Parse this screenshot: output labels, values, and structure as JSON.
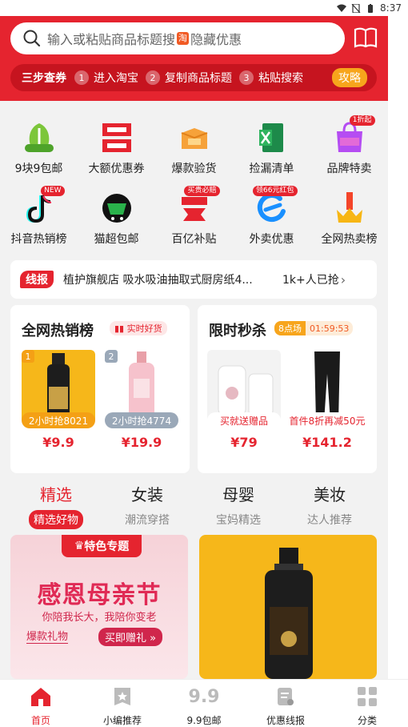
{
  "status": {
    "time": "8:37"
  },
  "search": {
    "placeholder_pre": "输入或粘贴商品标题搜",
    "badge": "淘",
    "placeholder_post": "隐藏优惠"
  },
  "steps": {
    "lead": "三步查券",
    "items": [
      {
        "num": "1",
        "label": "进入淘宝"
      },
      {
        "num": "2",
        "label": "复制商品标题"
      },
      {
        "num": "3",
        "label": "粘贴搜索"
      }
    ],
    "guide": "攻略"
  },
  "categories": [
    {
      "label": "9块9包邮",
      "icon": "white-price-icon",
      "tag": ""
    },
    {
      "label": "大额优惠券",
      "icon": "coupon-drop-icon",
      "tag": ""
    },
    {
      "label": "爆款验货",
      "icon": "unbox-icon",
      "tag": ""
    },
    {
      "label": "捡漏清单",
      "icon": "excel-list-icon",
      "tag": ""
    },
    {
      "label": "品牌特卖",
      "icon": "sale-bag-icon",
      "tag": "1折起"
    },
    {
      "label": "抖音热销榜",
      "icon": "tiktok-icon",
      "tag": "NEW"
    },
    {
      "label": "猫超包邮",
      "icon": "supermarket-icon",
      "tag": ""
    },
    {
      "label": "百亿补贴",
      "icon": "ju-icon",
      "tag": "买贵必赔"
    },
    {
      "label": "外卖优惠",
      "icon": "eleme-icon",
      "tag": "领66元红包"
    },
    {
      "label": "全网热卖榜",
      "icon": "crown-icon",
      "tag": ""
    }
  ],
  "news": {
    "badge": "线报",
    "text": "植护旗舰店 吸水吸油抽取式厨房纸4...",
    "count": "1k+人已抢"
  },
  "hot": {
    "title": "全网热销榜",
    "badge": "实时好货",
    "products": [
      {
        "rank": "1",
        "label": "2小时抢8021",
        "price": "¥9.9"
      },
      {
        "rank": "2",
        "label": "2小时抢4774",
        "price": "¥19.9"
      }
    ]
  },
  "flash": {
    "title": "限时秒杀",
    "session": "8点场",
    "countdown": "01:59:53",
    "products": [
      {
        "label": "买就送赠品",
        "price": "¥79"
      },
      {
        "label": "首件8折再减50元",
        "price": "¥141.2"
      }
    ]
  },
  "tabs": [
    {
      "title": "精选",
      "sub": "精选好物"
    },
    {
      "title": "女装",
      "sub": "潮流穿搭"
    },
    {
      "title": "母婴",
      "sub": "宝妈精选"
    },
    {
      "title": "美妆",
      "sub": "达人推荐"
    }
  ],
  "banner": {
    "tag": "特色专题",
    "headline": "感恩母亲节",
    "sub": "你陪我长大，我陪你变老",
    "left": "爆款礼物",
    "button": "买即赠礼 »"
  },
  "nav": [
    {
      "label": "首页",
      "icon": "home-icon"
    },
    {
      "label": "小编推荐",
      "icon": "editor-pick-icon"
    },
    {
      "label": "9.9包邮",
      "icon": "nine-nine-icon"
    },
    {
      "label": "优惠线报",
      "icon": "deal-report-icon"
    },
    {
      "label": "分类",
      "icon": "category-grid-icon"
    }
  ],
  "colors": {
    "brand_red": "#e5242f",
    "accent_orange": "#f7a51c"
  }
}
